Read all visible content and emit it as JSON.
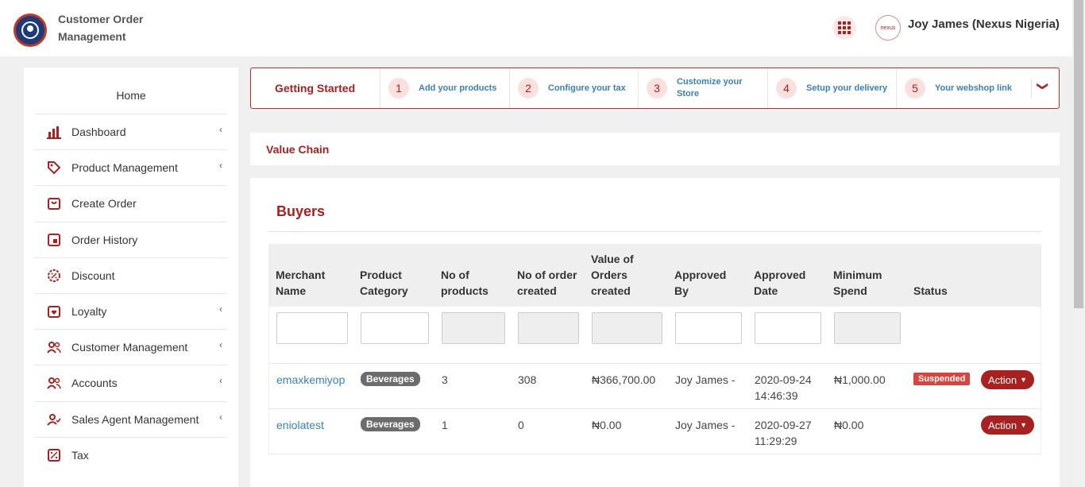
{
  "header": {
    "app_title": "Customer Order Management",
    "user_name": "Joy James (Nexus Nigeria)",
    "avatar_text": "nexus",
    "logo_icon": "customer-logo-icon",
    "apps_icon": "grid-icon"
  },
  "sidebar": {
    "home": "Home",
    "items": [
      {
        "label": "Dashboard",
        "icon": "bar-chart-icon",
        "has_sub": true
      },
      {
        "label": "Product Management",
        "icon": "tag-icon",
        "has_sub": true
      },
      {
        "label": "Create Order",
        "icon": "cart-icon",
        "has_sub": false
      },
      {
        "label": "Order History",
        "icon": "history-icon",
        "has_sub": false
      },
      {
        "label": "Discount",
        "icon": "discount-icon",
        "has_sub": false
      },
      {
        "label": "Loyalty",
        "icon": "loyalty-icon",
        "has_sub": true
      },
      {
        "label": "Customer Management",
        "icon": "users-icon",
        "has_sub": true
      },
      {
        "label": "Accounts",
        "icon": "accounts-icon",
        "has_sub": true
      },
      {
        "label": "Sales Agent Management",
        "icon": "agent-icon",
        "has_sub": true
      },
      {
        "label": "Tax",
        "icon": "tax-icon",
        "has_sub": false
      }
    ],
    "chevron": "‹"
  },
  "getting_started": {
    "title": "Getting Started",
    "steps": [
      {
        "num": "1",
        "label": "Add your products"
      },
      {
        "num": "2",
        "label": "Configure your tax"
      },
      {
        "num": "3",
        "label": "Customize your Store"
      },
      {
        "num": "4",
        "label": "Setup your delivery"
      },
      {
        "num": "5",
        "label": "Your webshop link"
      }
    ],
    "expand_icon": "chevron-down-icon",
    "expand_glyph": "❯"
  },
  "value_chain": {
    "title": "Value Chain"
  },
  "buyers": {
    "title": "Buyers",
    "columns": [
      "Merchant Name",
      "Product Category",
      "No of products",
      "No of order created",
      "Value of Orders created",
      "Approved By",
      "Approved Date",
      "Minimum Spend",
      "Status"
    ],
    "rows": [
      {
        "merchant": "emaxkemiyop",
        "category": "Beverages",
        "products": "3",
        "orders": "308",
        "value": "₦366,700.00",
        "approved_by": "Joy James -",
        "approved_date": "2020-09-24 14:46:39",
        "min_spend": "₦1,000.00",
        "status": "Suspended",
        "action": "Action"
      },
      {
        "merchant": "eniolatest",
        "category": "Beverages",
        "products": "1",
        "orders": "0",
        "value": "₦0.00",
        "approved_by": "Joy James -",
        "approved_date": "2020-09-27 11:29:29",
        "min_spend": "₦0.00",
        "status": "",
        "action": "Action"
      }
    ]
  },
  "colors": {
    "brand": "#a8201f",
    "link": "#3b7fb5",
    "status_suspended": "#d9453d"
  }
}
